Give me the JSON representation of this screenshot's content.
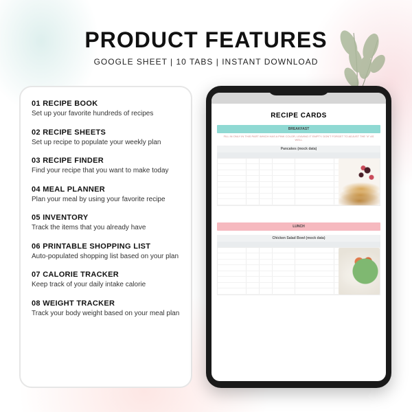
{
  "header": {
    "title": "PRODUCT FEATURES",
    "subtitle": "GOOGLE SHEET | 10 TABS | INSTANT DOWNLOAD"
  },
  "features": [
    {
      "title": "01 RECIPE BOOK",
      "desc": "Set up your favorite hundreds of recipes"
    },
    {
      "title": "02 RECIPE SHEETS",
      "desc": "Set up recipe to populate your weekly plan"
    },
    {
      "title": "03 RECIPE FINDER",
      "desc": "Find your recipe that you want to make today"
    },
    {
      "title": "04 MEAL PLANNER",
      "desc": "Plan your meal by using your favorite recipe"
    },
    {
      "title": "05 INVENTORY",
      "desc": "Track the items that you already have"
    },
    {
      "title": "06 PRINTABLE SHOPPING LIST",
      "desc": "Auto-populated shopping list based on your plan"
    },
    {
      "title": "07 CALORIE TRACKER",
      "desc": "Keep track of your daily intake calorie"
    },
    {
      "title": "08 WEIGHT TRACKER",
      "desc": "Track your body weight based on your meal plan"
    }
  ],
  "tablet": {
    "sheet_title": "RECIPE CARDS",
    "sections": {
      "breakfast": {
        "label": "BREAKFAST",
        "note": "FILL IN ONLY IN THIS PART WHICH HAS A PINK COLOR, LEAVING IT EMPTY. DON'T FORGET TO ADJUST THE \"#\" AS WELL",
        "recipe_name": "Pancakes (mock data)"
      },
      "lunch": {
        "label": "LUNCH",
        "recipe_name": "Chicken Salad Bowl (mock data)"
      }
    }
  }
}
